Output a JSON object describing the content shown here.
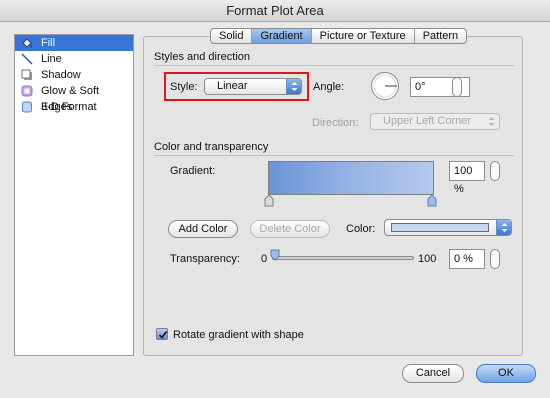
{
  "window": {
    "title": "Format Plot Area"
  },
  "sidebar": {
    "items": [
      {
        "label": "Fill",
        "icon": "paint-bucket-icon",
        "selected": true
      },
      {
        "label": "Line",
        "icon": "line-icon",
        "selected": false
      },
      {
        "label": "Shadow",
        "icon": "shadow-icon",
        "selected": false
      },
      {
        "label": "Glow & Soft Edges",
        "icon": "glow-icon",
        "selected": false
      },
      {
        "label": "3-D Format",
        "icon": "3d-format-icon",
        "selected": false
      }
    ]
  },
  "tabs": [
    {
      "label": "Solid",
      "active": false
    },
    {
      "label": "Gradient",
      "active": true
    },
    {
      "label": "Picture or Texture",
      "active": false
    },
    {
      "label": "Pattern",
      "active": false
    }
  ],
  "styles_direction": {
    "heading": "Styles and direction",
    "style_label": "Style:",
    "style_value": "Linear",
    "angle_label": "Angle:",
    "angle_value": "0°",
    "direction_label": "Direction:",
    "direction_value": "Upper Left Corner"
  },
  "color_transparency": {
    "heading": "Color and transparency",
    "gradient_label": "Gradient:",
    "gradient_percent": "100 %",
    "add_color": "Add Color",
    "delete_color": "Delete Color",
    "color_label": "Color:",
    "color_swatch": "#c6d6f3",
    "transparency_label": "Transparency:",
    "slider_min": "0",
    "slider_max": "100",
    "transparency_value": "0 %"
  },
  "rotate_checkbox": {
    "label": "Rotate gradient with shape",
    "checked": true
  },
  "footer": {
    "cancel": "Cancel",
    "ok": "OK"
  },
  "colors": {
    "accent": "#3875d7",
    "highlight": "#e0161b"
  }
}
